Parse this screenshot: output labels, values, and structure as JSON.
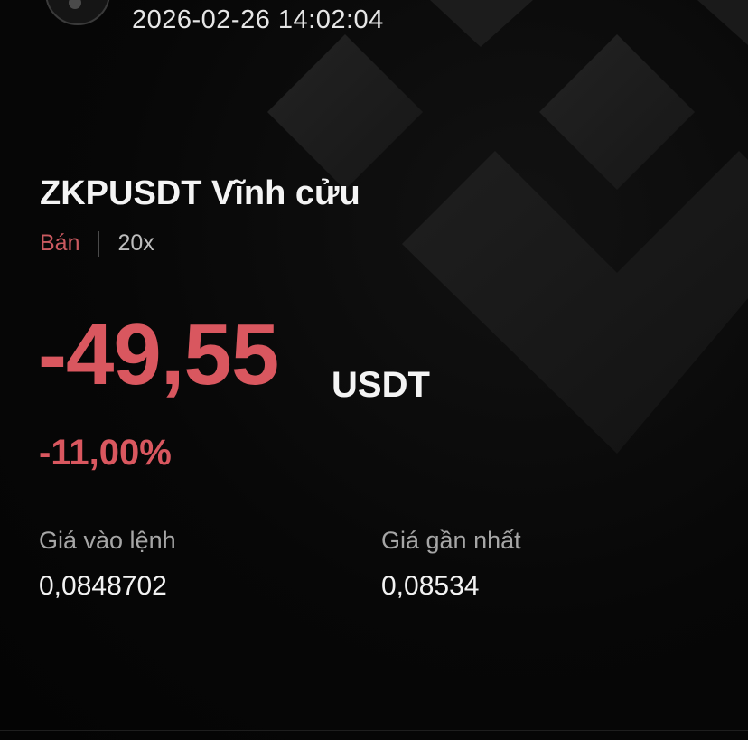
{
  "header": {
    "timestamp": "2026-02-26 14:02:04"
  },
  "position": {
    "symbol": "ZKPUSDT Vĩnh cửu",
    "side": "Bán",
    "leverage": "20x",
    "pnl": "-49,55",
    "pnl_unit": "USDT",
    "roi": "-11,00%"
  },
  "prices": {
    "entry_label": "Giá vào lệnh",
    "entry_value": "0,0848702",
    "last_label": "Giá gần nhất",
    "last_value": "0,08534"
  },
  "colors": {
    "loss": "#d9575f",
    "background": "#050505",
    "text": "#f4f4f4",
    "muted": "#a6a6a6"
  },
  "icons": {
    "background_logo": "binance-logo-icon",
    "avatar": "user-avatar"
  }
}
